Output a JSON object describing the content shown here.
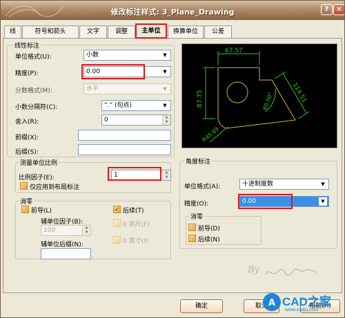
{
  "window": {
    "title": "修改标注样式: 3_Plane_Drawing",
    "help_label": "?",
    "close_label": "×"
  },
  "tabs": [
    {
      "label": "线"
    },
    {
      "label": "符号和箭头"
    },
    {
      "label": "文字"
    },
    {
      "label": "调整"
    },
    {
      "label": "主单位"
    },
    {
      "label": "换算单位"
    },
    {
      "label": "公差"
    }
  ],
  "linear": {
    "group_label": "线性标注",
    "unit_format": {
      "label": "单位格式(U):",
      "value": "小数"
    },
    "precision": {
      "label": "精度(P):",
      "value": "0.00"
    },
    "fraction_format": {
      "label": "分数格式(M):",
      "value": "水平"
    },
    "decimal_sep": {
      "label": "小数分隔符(C):",
      "value": "“.” (句点)"
    },
    "round_off": {
      "label": "舍入(R):",
      "value": "0"
    },
    "prefix": {
      "label": "前缀(X):",
      "value": ""
    },
    "suffix": {
      "label": "后缀(S):",
      "value": ""
    }
  },
  "scale": {
    "group_label": "测量单位比例",
    "factor": {
      "label": "比例因子(E):",
      "value": "1"
    },
    "layout_only": "仅应用到布局标注"
  },
  "zero_suppress": {
    "group_label": "消零",
    "leading": "前导(L)",
    "trailing": "后续(T)",
    "sub_unit_factor": {
      "label": "辅单位因子(B):",
      "value": "100"
    },
    "sub_unit_suffix": {
      "label": "辅单位后缀(N):",
      "value": ""
    },
    "feet": "0 英尺(F)",
    "inches": "0 英寸(I)"
  },
  "angular": {
    "group_label": "角度标注",
    "unit_format": {
      "label": "单位格式(A):",
      "value": "十进制度数"
    },
    "precision": {
      "label": "精度(O):",
      "value": "0.00"
    },
    "zero_label": "消零",
    "leading": "前导(D)",
    "trailing": "后续(N)"
  },
  "preview": {
    "dim_top": "67.57",
    "dim_left": "87.75",
    "dim_right": "114.51",
    "dim_angle": "60.00°",
    "dim_radius": "R45.69"
  },
  "buttons": {
    "ok": "确定",
    "cancel": "取消",
    "help": "帮助(H)"
  },
  "watermark": {
    "by": "By"
  },
  "logo": {
    "text": "CAD之家",
    "url": "www.cadzj.com"
  },
  "colors": {
    "preview_bg": "#000000",
    "dim_green": "#2ec820",
    "shape_yellow": "#d8b23a",
    "highlight_red": "#e0141a"
  }
}
